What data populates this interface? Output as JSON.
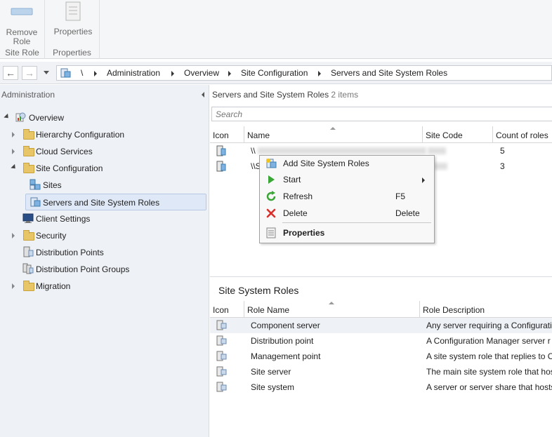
{
  "ribbon": {
    "remove_role_label": "Remove Role",
    "site_role_group": "Site Role",
    "properties_label": "Properties",
    "properties_group": "Properties"
  },
  "address": {
    "root": "\\",
    "crumbs": [
      "Administration",
      "Overview",
      "Site Configuration",
      "Servers and Site System Roles"
    ]
  },
  "nav": {
    "title": "Administration",
    "items": [
      {
        "label": "Overview"
      },
      {
        "label": "Hierarchy Configuration"
      },
      {
        "label": "Cloud Services"
      },
      {
        "label": "Site Configuration"
      },
      {
        "label": "Sites"
      },
      {
        "label": "Servers and Site System Roles"
      },
      {
        "label": "Client Settings"
      },
      {
        "label": "Security"
      },
      {
        "label": "Distribution Points"
      },
      {
        "label": "Distribution Point Groups"
      },
      {
        "label": "Migration"
      }
    ]
  },
  "content": {
    "title": "Servers and Site System Roles",
    "count": "2 items",
    "search_placeholder": "Search",
    "columns": [
      "Icon",
      "Name",
      "Site Code",
      "Count of roles"
    ],
    "rows": [
      {
        "name": "\\\\",
        "roles": "5"
      },
      {
        "name": "\\\\S",
        "roles": "3"
      }
    ]
  },
  "roles_panel": {
    "title": "Site System Roles",
    "columns": [
      "Icon",
      "Role Name",
      "Role Description"
    ],
    "rows": [
      {
        "name": "Component server",
        "desc": "Any server requiring a Configurati"
      },
      {
        "name": "Distribution point",
        "desc": "A Configuration Manager server r"
      },
      {
        "name": "Management point",
        "desc": "A site system role that replies to C"
      },
      {
        "name": "Site server",
        "desc": "The main site system role that hos"
      },
      {
        "name": "Site system",
        "desc": "A server or server share that hosts"
      }
    ]
  },
  "context_menu": {
    "items": [
      {
        "label": "Add Site System Roles",
        "key": ""
      },
      {
        "label": "Start",
        "key": ""
      },
      {
        "label": "Refresh",
        "key": "F5"
      },
      {
        "label": "Delete",
        "key": "Delete"
      },
      {
        "label": "Properties",
        "key": ""
      }
    ]
  },
  "colors": {
    "accent": "#3c7fb1",
    "selection": "#dfe8f6",
    "folder": "#e8c668",
    "delete_red": "#d9302c",
    "start_green": "#3aa635"
  }
}
